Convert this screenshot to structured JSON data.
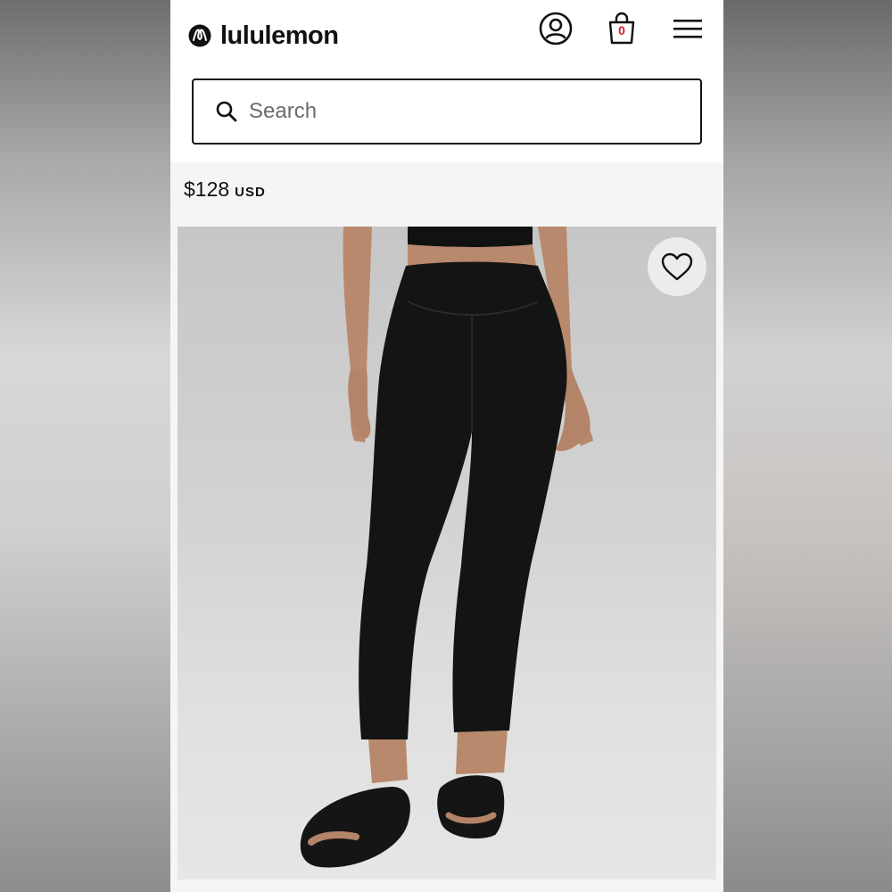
{
  "brand": {
    "name": "lululemon"
  },
  "header": {
    "icons": [
      "account-icon",
      "shopping-bag-icon",
      "menu-icon"
    ],
    "bag_count": "0"
  },
  "search": {
    "placeholder": "Search",
    "value": ""
  },
  "product": {
    "price_amount": "$128",
    "price_currency": "USD",
    "favorite_icon": "heart-icon"
  },
  "colors": {
    "brand_red": "#d31f26",
    "text": "#111111",
    "page_bg": "#f5f5f5"
  }
}
